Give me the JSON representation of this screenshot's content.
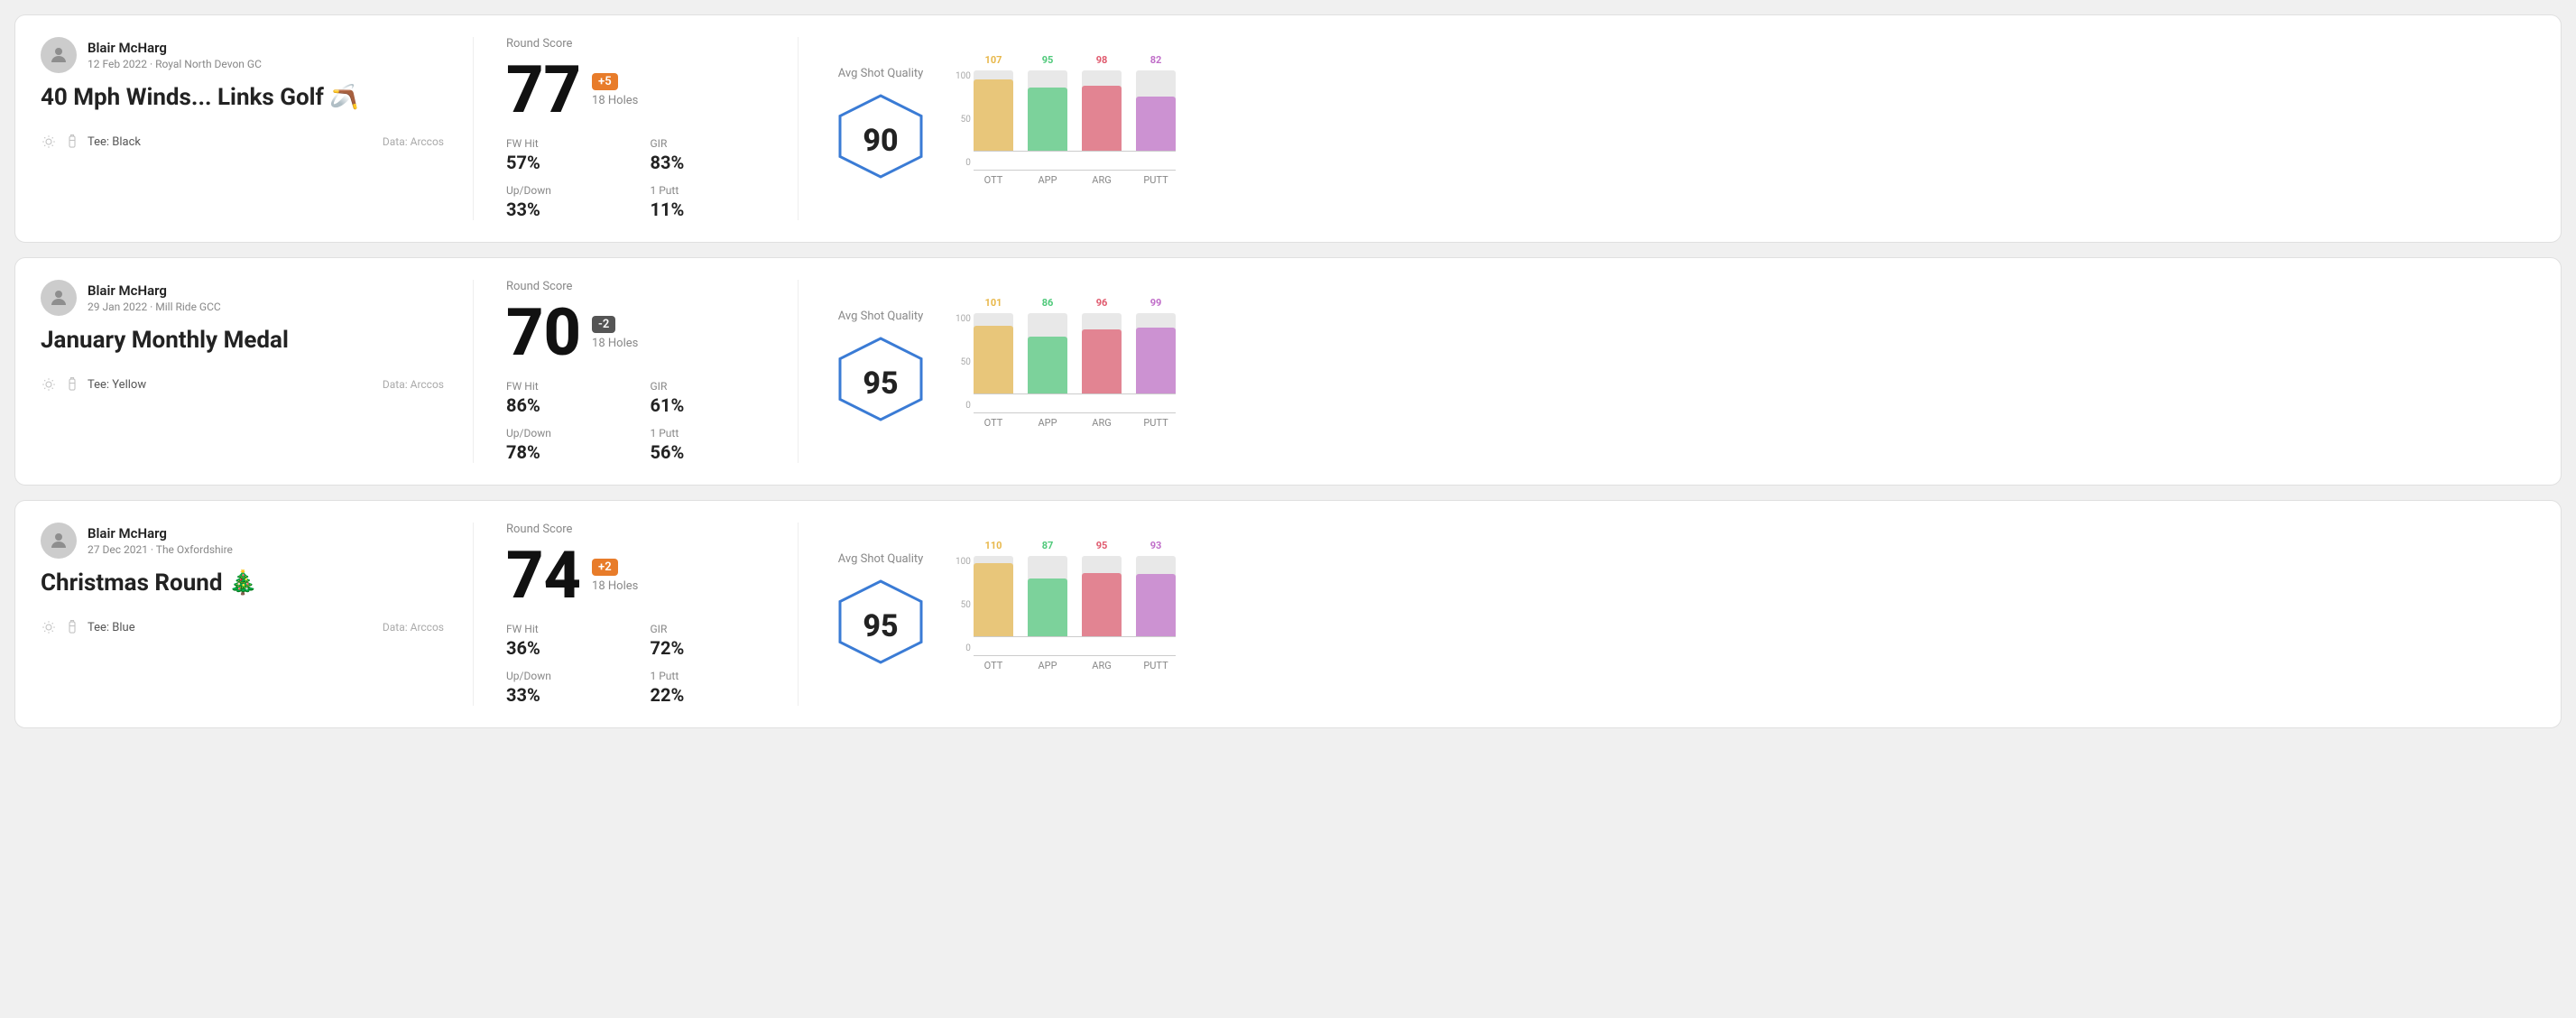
{
  "rounds": [
    {
      "name": "Blair McHarg",
      "date": "12 Feb 2022 · Royal North Devon GC",
      "title": "40 Mph Winds... Links Golf 🪃",
      "tee": "Black",
      "dataSource": "Data: Arccos",
      "roundScore": "77",
      "scoreDiff": "+5",
      "diffType": "positive",
      "holes": "18 Holes",
      "fwHit": "57%",
      "gir": "83%",
      "upDown": "33%",
      "onePutt": "11%",
      "avgShotQuality": "90",
      "chart": {
        "bars": [
          {
            "label": "OTT",
            "value": 107,
            "color": "#e8b84b"
          },
          {
            "label": "APP",
            "value": 95,
            "color": "#4fc97a"
          },
          {
            "label": "ARG",
            "value": 98,
            "color": "#e05a6e"
          },
          {
            "label": "PUTT",
            "value": 82,
            "color": "#c06ec9"
          }
        ]
      }
    },
    {
      "name": "Blair McHarg",
      "date": "29 Jan 2022 · Mill Ride GCC",
      "title": "January Monthly Medal",
      "tee": "Yellow",
      "dataSource": "Data: Arccos",
      "roundScore": "70",
      "scoreDiff": "-2",
      "diffType": "negative",
      "holes": "18 Holes",
      "fwHit": "86%",
      "gir": "61%",
      "upDown": "78%",
      "onePutt": "56%",
      "avgShotQuality": "95",
      "chart": {
        "bars": [
          {
            "label": "OTT",
            "value": 101,
            "color": "#e8b84b"
          },
          {
            "label": "APP",
            "value": 86,
            "color": "#4fc97a"
          },
          {
            "label": "ARG",
            "value": 96,
            "color": "#e05a6e"
          },
          {
            "label": "PUTT",
            "value": 99,
            "color": "#c06ec9"
          }
        ]
      }
    },
    {
      "name": "Blair McHarg",
      "date": "27 Dec 2021 · The Oxfordshire",
      "title": "Christmas Round 🎄",
      "tee": "Blue",
      "dataSource": "Data: Arccos",
      "roundScore": "74",
      "scoreDiff": "+2",
      "diffType": "positive",
      "holes": "18 Holes",
      "fwHit": "36%",
      "gir": "72%",
      "upDown": "33%",
      "onePutt": "22%",
      "avgShotQuality": "95",
      "chart": {
        "bars": [
          {
            "label": "OTT",
            "value": 110,
            "color": "#e8b84b"
          },
          {
            "label": "APP",
            "value": 87,
            "color": "#4fc97a"
          },
          {
            "label": "ARG",
            "value": 95,
            "color": "#e05a6e"
          },
          {
            "label": "PUTT",
            "value": 93,
            "color": "#c06ec9"
          }
        ]
      }
    }
  ],
  "labels": {
    "roundScore": "Round Score",
    "fwHit": "FW Hit",
    "gir": "GIR",
    "upDown": "Up/Down",
    "onePutt": "1 Putt",
    "avgShotQuality": "Avg Shot Quality",
    "yAxis": [
      "100",
      "50",
      "0"
    ]
  }
}
